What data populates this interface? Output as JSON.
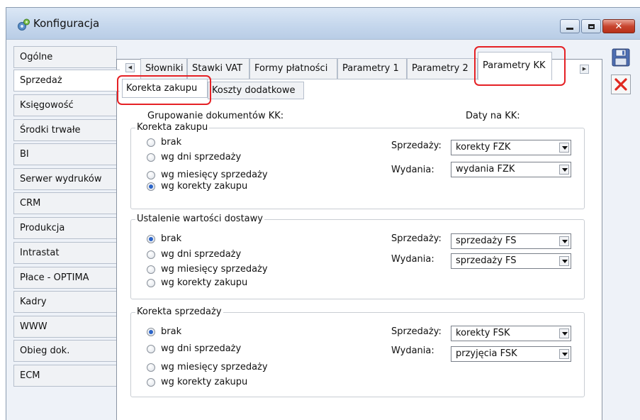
{
  "window": {
    "title": "Konfiguracja",
    "close_label": "✕"
  },
  "sidebar": {
    "items": [
      {
        "label": "Ogólne"
      },
      {
        "label": "Sprzedaż"
      },
      {
        "label": "Księgowość"
      },
      {
        "label": "Środki trwałe"
      },
      {
        "label": "BI"
      },
      {
        "label": "Serwer wydruków"
      },
      {
        "label": "CRM"
      },
      {
        "label": "Produkcja"
      },
      {
        "label": "Intrastat"
      },
      {
        "label": "Płace - OPTIMA"
      },
      {
        "label": "Kadry"
      },
      {
        "label": "WWW"
      },
      {
        "label": "Obieg dok."
      },
      {
        "label": "ECM"
      }
    ],
    "selected": "Sprzedaż"
  },
  "tabs": {
    "items": [
      {
        "label": "Słowniki"
      },
      {
        "label": "Stawki VAT"
      },
      {
        "label": "Formy płatności"
      },
      {
        "label": "Parametry 1"
      },
      {
        "label": "Parametry 2"
      },
      {
        "label": "Parametry KK"
      }
    ],
    "active": "Parametry KK"
  },
  "subtabs": {
    "items": [
      {
        "label": "Korekta zakupu"
      },
      {
        "label": "Koszty dodatkowe"
      }
    ],
    "active": "Korekta zakupu"
  },
  "headers": {
    "grouping": "Grupowanie dokumentów KK:",
    "dates": "Daty na KK:"
  },
  "groups": [
    {
      "title": "Korekta zakupu",
      "options": [
        "brak",
        "wg dni sprzedaży",
        "wg miesięcy sprzedaży",
        "wg korekty zakupu"
      ],
      "selected": "wg korekty zakupu",
      "sprzedazy_label": "Sprzedaży:",
      "sprzedazy_value": "korekty FZK",
      "wydania_label": "Wydania:",
      "wydania_value": "wydania FZK"
    },
    {
      "title": "Ustalenie wartości dostawy",
      "options": [
        "brak",
        "wg dni sprzedaży",
        "wg miesięcy sprzedaży",
        "wg korekty zakupu"
      ],
      "selected": "brak",
      "sprzedazy_label": "Sprzedaży:",
      "sprzedazy_value": "sprzedaży FS",
      "wydania_label": "Wydania:",
      "wydania_value": "sprzedaży FS"
    },
    {
      "title": "Korekta sprzedaży",
      "options": [
        "brak",
        "wg dni sprzedaży",
        "wg miesięcy sprzedaży",
        "wg korekty zakupu"
      ],
      "selected": "brak",
      "sprzedazy_label": "Sprzedaży:",
      "sprzedazy_value": "korekty FSK",
      "wydania_label": "Wydania:",
      "wydania_value": "przyjęcia FSK"
    }
  ],
  "colors": {
    "highlight": "#e52125",
    "radio_checked": "#2b64c8"
  },
  "icons": {
    "app": "gear-icon",
    "save": "floppy-disk-icon",
    "cancel": "red-x-icon"
  }
}
